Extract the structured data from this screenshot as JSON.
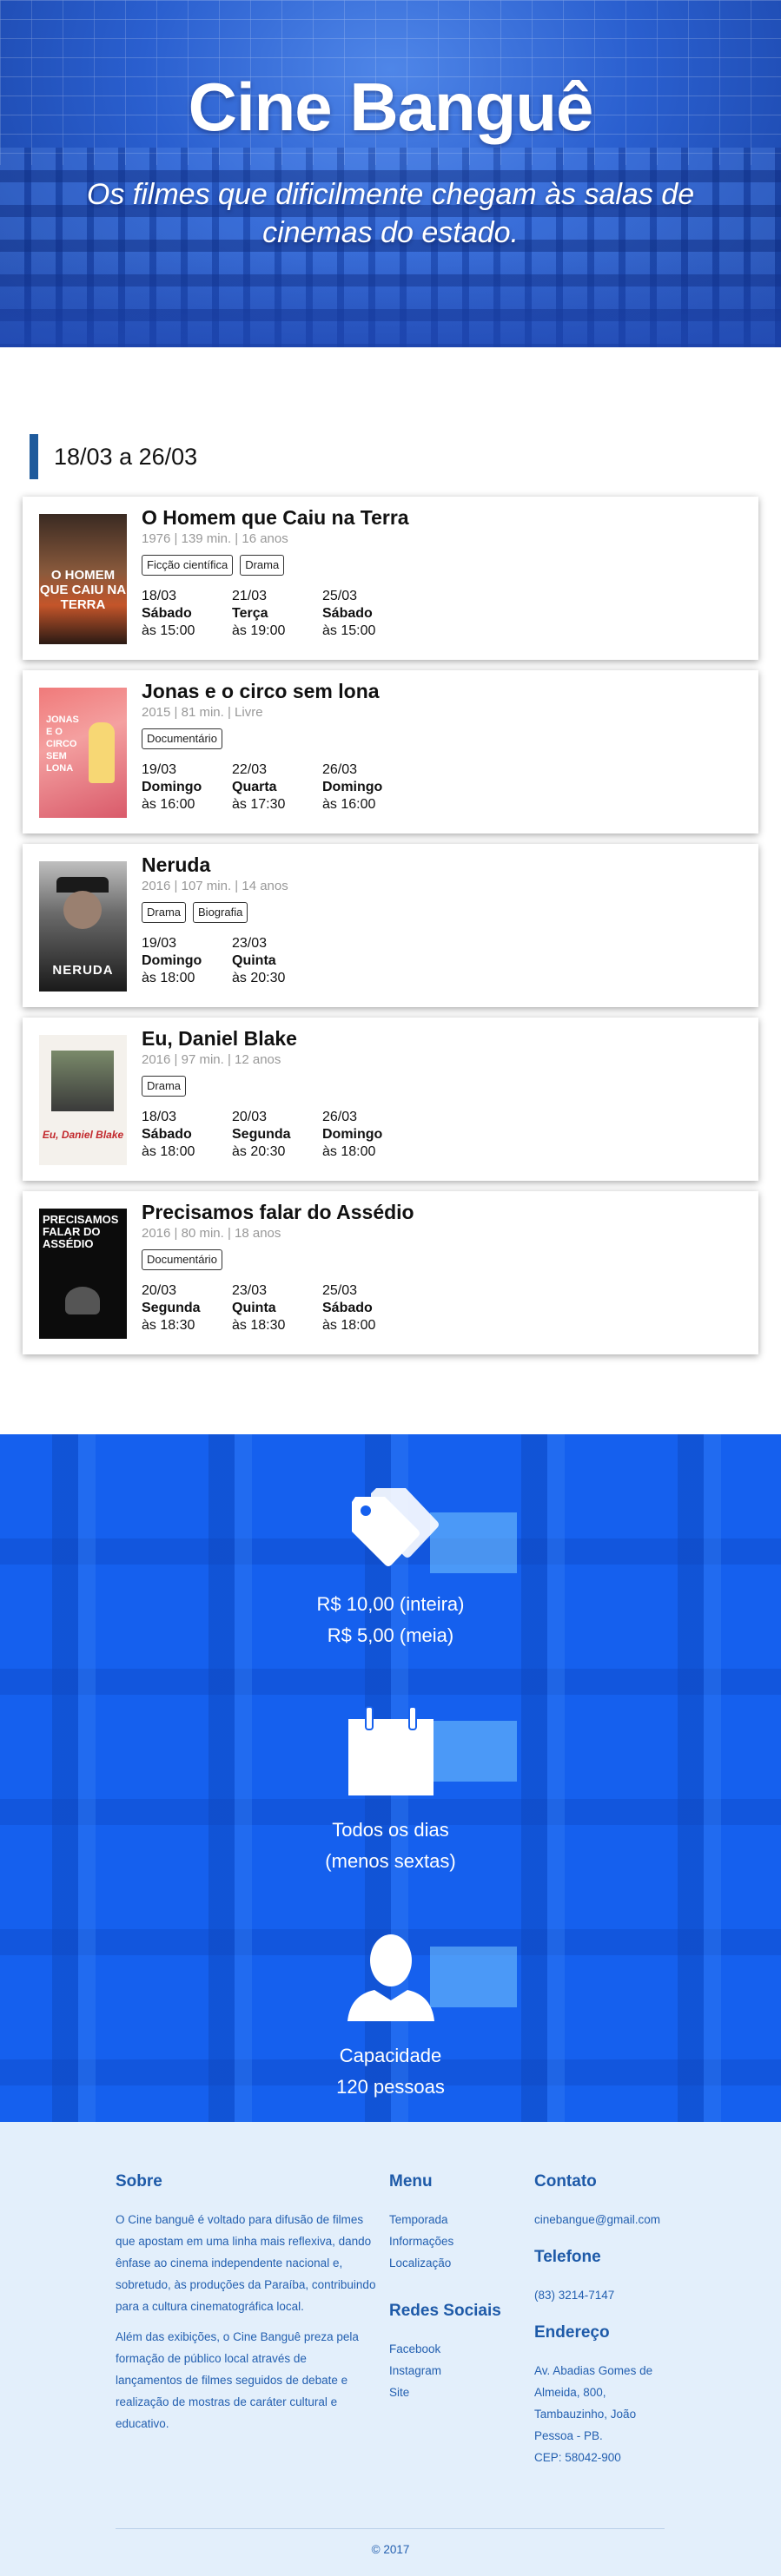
{
  "hero": {
    "title": "Cine Banguê",
    "subtitle": "Os filmes que dificilmente chegam às salas de cinemas do estado."
  },
  "schedule": {
    "period": "18/03 a 26/03",
    "movies": [
      {
        "title": "O Homem que Caiu na Terra",
        "meta": "1976 | 139 min. | 16 anos",
        "tags": [
          "Ficção científica",
          "Drama"
        ],
        "poster_text": "O HOMEM QUE CAIU NA TERRA",
        "sessions": [
          {
            "date": "18/03",
            "day": "Sábado",
            "time": "às 15:00"
          },
          {
            "date": "21/03",
            "day": "Terça",
            "time": "às 19:00"
          },
          {
            "date": "25/03",
            "day": "Sábado",
            "time": "às 15:00"
          }
        ]
      },
      {
        "title": "Jonas e o circo sem lona",
        "meta": "2015 | 81 min. | Livre",
        "tags": [
          "Documentário"
        ],
        "poster_text": "JONAS E O CIRCO SEM LONA",
        "sessions": [
          {
            "date": "19/03",
            "day": "Domingo",
            "time": "às 16:00"
          },
          {
            "date": "22/03",
            "day": "Quarta",
            "time": "às 17:30"
          },
          {
            "date": "26/03",
            "day": "Domingo",
            "time": "às 16:00"
          }
        ]
      },
      {
        "title": "Neruda",
        "meta": "2016 | 107 min. | 14 anos",
        "tags": [
          "Drama",
          "Biografia"
        ],
        "poster_text": "NERUDA",
        "sessions": [
          {
            "date": "19/03",
            "day": "Domingo",
            "time": "às 18:00"
          },
          {
            "date": "23/03",
            "day": "Quinta",
            "time": "às 20:30"
          }
        ]
      },
      {
        "title": "Eu, Daniel Blake",
        "meta": "2016 | 97 min. | 12 anos",
        "tags": [
          "Drama"
        ],
        "poster_text": "Eu, Daniel Blake",
        "sessions": [
          {
            "date": "18/03",
            "day": "Sábado",
            "time": "às 18:00"
          },
          {
            "date": "20/03",
            "day": "Segunda",
            "time": "às 20:30"
          },
          {
            "date": "26/03",
            "day": "Domingo",
            "time": "às 18:00"
          }
        ]
      },
      {
        "title": "Precisamos falar do Assédio",
        "meta": "2016 | 80 min. | 18 anos",
        "tags": [
          "Documentário"
        ],
        "poster_text": "PRECISAMOS FALAR DO ASSÉDIO",
        "sessions": [
          {
            "date": "20/03",
            "day": "Segunda",
            "time": "às 18:30"
          },
          {
            "date": "23/03",
            "day": "Quinta",
            "time": "às 18:30"
          },
          {
            "date": "25/03",
            "day": "Sábado",
            "time": "às 18:00"
          }
        ]
      }
    ]
  },
  "info": {
    "price": {
      "icon": "price-tag-icon",
      "line1": "R$ 10,00 (inteira)",
      "line2": "R$ 5,00 (meia)"
    },
    "days": {
      "icon": "calendar-icon",
      "line1": "Todos os dias",
      "line2": "(menos sextas)"
    },
    "capacity": {
      "icon": "user-icon",
      "line1": "Capacidade",
      "line2": "120 pessoas"
    }
  },
  "footer": {
    "about": {
      "heading": "Sobre",
      "p1": "O Cine banguê é voltado para difusão de filmes que apostam em uma linha mais reflexiva, dando ênfase ao cinema independente nacional e, sobretudo, às produções da Paraíba, contribuindo para a cultura cinematográfica local.",
      "p2": "Além das exibições, o Cine Banguê preza pela formação de público local através de lançamentos de filmes seguidos de debate e realização de mostras de caráter cultural e educativo."
    },
    "menu": {
      "heading": "Menu",
      "items": [
        "Temporada",
        "Informações",
        "Localização"
      ]
    },
    "social": {
      "heading": "Redes Sociais",
      "items": [
        "Facebook",
        "Instagram",
        "Site"
      ]
    },
    "contact": {
      "heading": "Contato",
      "email": "cinebangue@gmail.com"
    },
    "phone": {
      "heading": "Telefone",
      "value": "(83) 3214-7147"
    },
    "address": {
      "heading": "Endereço",
      "lines": [
        "Av. Abadias Gomes de",
        "Almeida, 800,",
        "Tambauzinho, João",
        "Pessoa - PB.",
        "CEP: 58042-900"
      ]
    },
    "copyright": "© 2017"
  }
}
